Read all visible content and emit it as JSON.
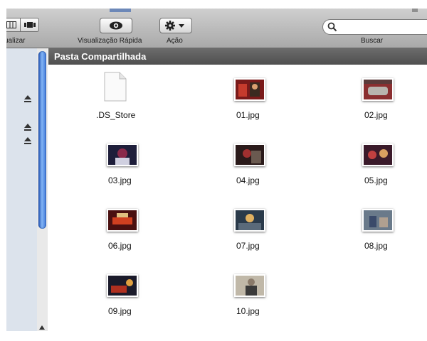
{
  "toolbar": {
    "view_label": "ualizar",
    "quicklook_label": "Visualização Rápida",
    "action_label": "Ação",
    "search_label": "Buscar",
    "search_value": ""
  },
  "pathbar": {
    "title": "Pasta Compartilhada"
  },
  "files": [
    {
      "name": ".DS_Store",
      "icon": "document-icon"
    },
    {
      "name": "01.jpg",
      "icon": "photo-thumbnail",
      "colors": [
        "#7a1a1a",
        "#c63b2d",
        "#3a2a20"
      ]
    },
    {
      "name": "02.jpg",
      "icon": "photo-thumbnail",
      "colors": [
        "#8a2e30",
        "#b8b3ae",
        "#5a3a3a"
      ]
    },
    {
      "name": "03.jpg",
      "icon": "photo-thumbnail",
      "colors": [
        "#1e1e3a",
        "#8a2a4a",
        "#d0d0e0"
      ]
    },
    {
      "name": "04.jpg",
      "icon": "photo-thumbnail",
      "colors": [
        "#2a1a1a",
        "#a03030",
        "#6a5a50"
      ]
    },
    {
      "name": "05.jpg",
      "icon": "photo-thumbnail",
      "colors": [
        "#3a1a2a",
        "#c04040",
        "#d8a060"
      ]
    },
    {
      "name": "06.jpg",
      "icon": "photo-thumbnail",
      "colors": [
        "#4a1010",
        "#d04020",
        "#e0c080"
      ]
    },
    {
      "name": "07.jpg",
      "icon": "photo-thumbnail",
      "colors": [
        "#2a3a4a",
        "#e0b060",
        "#5a6a7a"
      ]
    },
    {
      "name": "08.jpg",
      "icon": "photo-thumbnail",
      "colors": [
        "#6a7a8a",
        "#3a4a6a",
        "#b0a090"
      ]
    },
    {
      "name": "09.jpg",
      "icon": "photo-thumbnail",
      "colors": [
        "#1a1a2a",
        "#b03020",
        "#e0a040"
      ]
    },
    {
      "name": "10.jpg",
      "icon": "photo-thumbnail",
      "colors": [
        "#c0b8a8",
        "#3a3a3a",
        "#8a7a6a"
      ]
    }
  ]
}
